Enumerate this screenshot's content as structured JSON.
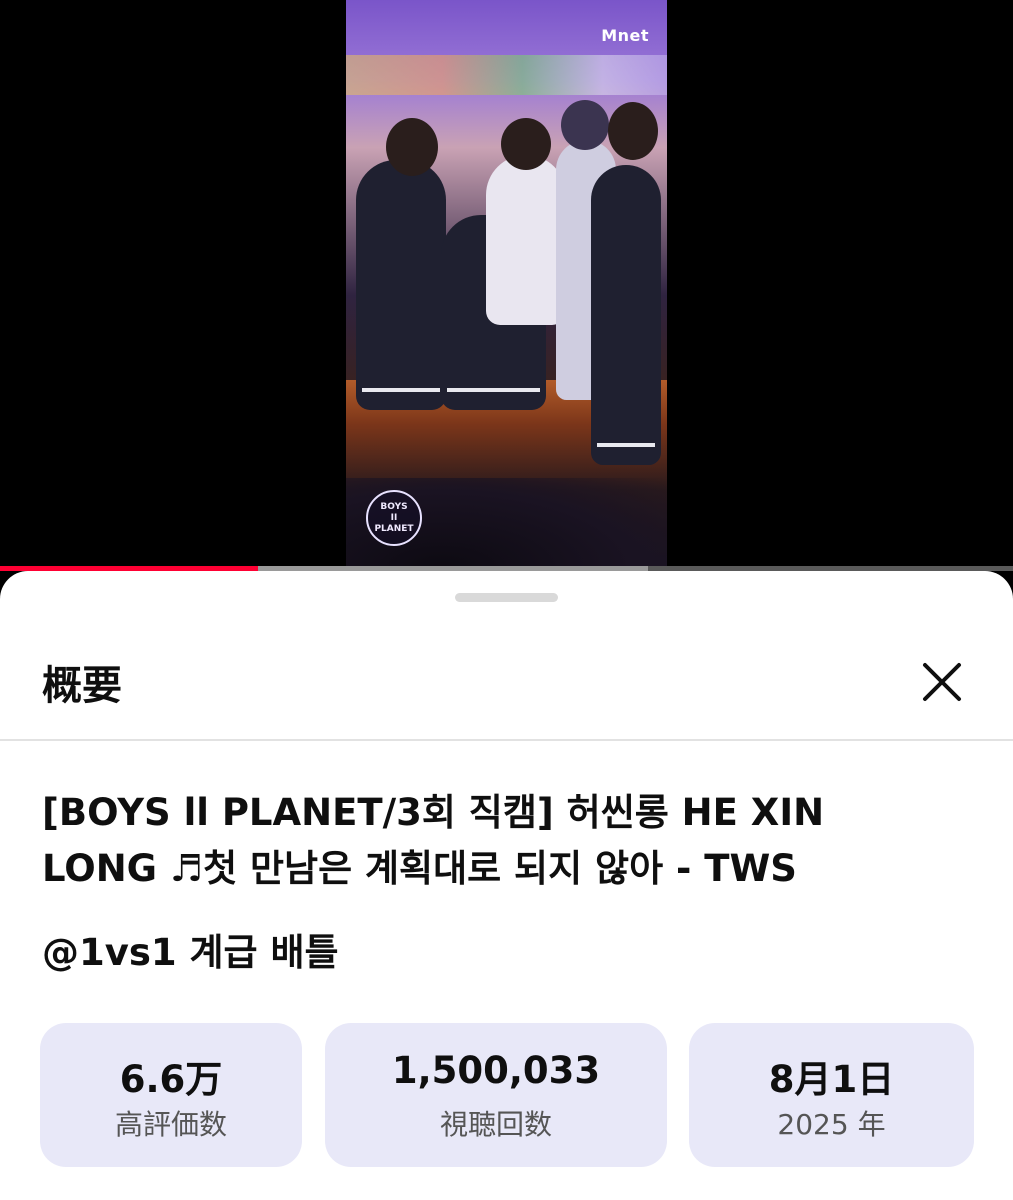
{
  "player": {
    "channel_logo": "Mnet",
    "show_badge_line1": "BOYS",
    "show_badge_line2": "II",
    "show_badge_line3": "PLANET",
    "progress_fraction": 0.255,
    "buffer_fraction": 0.64,
    "progress_color": "#ff0033"
  },
  "sheet": {
    "title": "概要",
    "close_icon": "close-icon"
  },
  "video": {
    "title": "[BOYS ll PLANET/3회 직캠] 허씬롱 HE XIN LONG ♬첫 만남은 계획대로 되지 않아 - TWS",
    "channel_handle": "@1vs1 계급 배틀"
  },
  "stats": [
    {
      "value": "6.6万",
      "label": "高評価数"
    },
    {
      "value": "1,500,033",
      "label": "視聴回数"
    },
    {
      "value": "8月1日",
      "label": "2025 年"
    }
  ]
}
